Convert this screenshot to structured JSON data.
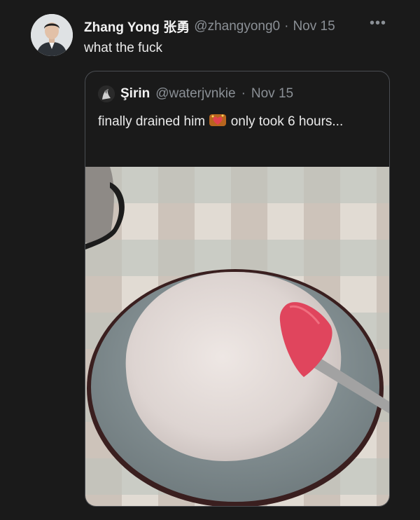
{
  "tweet": {
    "author_name": "Zhang Yong 张勇",
    "handle": "@zhangyong0",
    "separator": "·",
    "date": "Nov 15",
    "more_icon": "more-horizontal-icon",
    "text": "what the fuck"
  },
  "quoted": {
    "author_name": "Şirin",
    "handle": "@waterjvnkie",
    "separator": "·",
    "date": "Nov 15",
    "text_before": "finally drained him",
    "emoji_icon": "sparkle-heart-emoji-icon",
    "text_after": "only took 6 hours..."
  },
  "colors": {
    "background": "#1a1a1a",
    "text": "#e7e9ea",
    "muted": "#8b9096",
    "border": "#4a4d52",
    "spatula": "#e0455d"
  }
}
